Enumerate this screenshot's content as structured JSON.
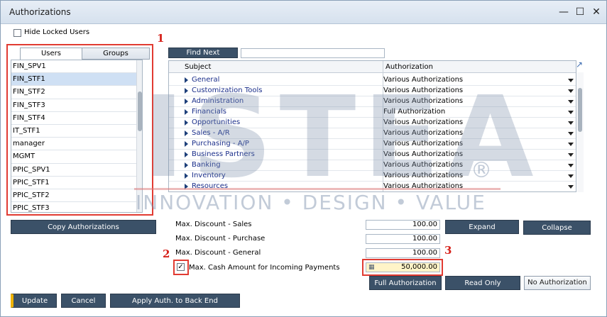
{
  "window": {
    "title": "Authorizations"
  },
  "hide_locked_users": {
    "label": "Hide Locked Users",
    "checked": false
  },
  "tabs": [
    {
      "label": "Users",
      "active": true
    },
    {
      "label": "Groups",
      "active": false
    }
  ],
  "users": [
    {
      "name": "FIN_SPV1",
      "selected": false
    },
    {
      "name": "FIN_STF1",
      "selected": true
    },
    {
      "name": "FIN_STF2",
      "selected": false
    },
    {
      "name": "FIN_STF3",
      "selected": false
    },
    {
      "name": "FIN_STF4",
      "selected": false
    },
    {
      "name": "IT_STF1",
      "selected": false
    },
    {
      "name": "manager",
      "selected": false
    },
    {
      "name": "MGMT",
      "selected": false
    },
    {
      "name": "PPIC_SPV1",
      "selected": false
    },
    {
      "name": "PPIC_STF1",
      "selected": false
    },
    {
      "name": "PPIC_STF2",
      "selected": false
    },
    {
      "name": "PPIC_STF3",
      "selected": false
    }
  ],
  "find_next": {
    "label": "Find Next",
    "value": ""
  },
  "grid": {
    "columns": {
      "subject": "Subject",
      "authorization": "Authorization"
    },
    "rows": [
      {
        "subject": "General",
        "authorization": "Various Authorizations"
      },
      {
        "subject": "Customization Tools",
        "authorization": "Various Authorizations"
      },
      {
        "subject": "Administration",
        "authorization": "Various Authorizations"
      },
      {
        "subject": "Financials",
        "authorization": "Full Authorization"
      },
      {
        "subject": "Opportunities",
        "authorization": "Various Authorizations"
      },
      {
        "subject": "Sales - A/R",
        "authorization": "Various Authorizations"
      },
      {
        "subject": "Purchasing - A/P",
        "authorization": "Various Authorizations"
      },
      {
        "subject": "Business Partners",
        "authorization": "Various Authorizations"
      },
      {
        "subject": "Banking",
        "authorization": "Various Authorizations"
      },
      {
        "subject": "Inventory",
        "authorization": "Various Authorizations"
      },
      {
        "subject": "Resources",
        "authorization": "Various Authorizations"
      }
    ]
  },
  "copy_authorizations": "Copy Authorizations",
  "discounts": [
    {
      "label": "Max. Discount - Sales",
      "value": "100.00"
    },
    {
      "label": "Max. Discount - Purchase",
      "value": "100.00"
    },
    {
      "label": "Max. Discount - General",
      "value": "100.00"
    }
  ],
  "max_cash": {
    "label": "Max. Cash Amount for Incoming Payments",
    "value": "50,000.00",
    "checked": true
  },
  "buttons": {
    "expand": "Expand",
    "collapse": "Collapse",
    "full_auth": "Full Authorization",
    "read_only": "Read Only",
    "no_auth": "No Authorization",
    "update": "Update",
    "cancel": "Cancel",
    "apply_back_end": "Apply Auth. to Back End"
  },
  "annotations": {
    "n1": "1",
    "n2": "2",
    "n3": "3"
  },
  "watermark": {
    "brand": "ISTEA",
    "tagline": "INNOVATION • DESIGN • VALUE",
    "reg": "®"
  },
  "colors": {
    "accent_dark": "#3b5168",
    "annotation_red": "#e13b32",
    "update_stripe": "#f0b400"
  }
}
